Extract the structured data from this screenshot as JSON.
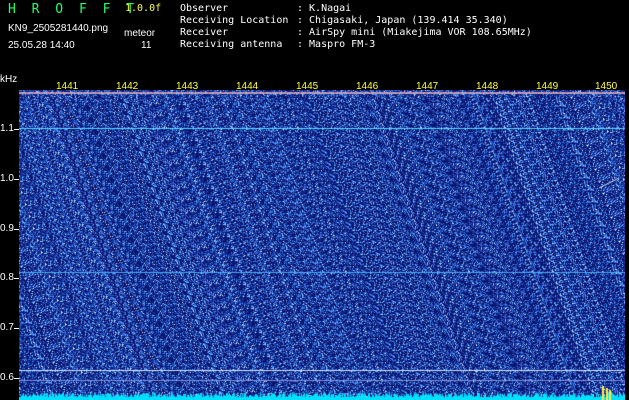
{
  "header": {
    "app_title": "H R O F F T",
    "version": "1.0.0f",
    "file_name": "KN9_2505281440.png",
    "meteor_label": "meteor",
    "datetime": "25.05.28 14:40",
    "meteor_count": "11"
  },
  "info": [
    {
      "key": "Observer",
      "value": ": K.Nagai"
    },
    {
      "key": "Receiving Location",
      "value": ": Chigasaki, Japan (139.414 35.340)"
    },
    {
      "key": "Receiver",
      "value": ": AirSpy mini (Miakejima VOR 108.65MHz)"
    },
    {
      "key": "Receiving antenna",
      "value": ": Maspro FM-3"
    }
  ],
  "spectrogram": {
    "y_unit": "kHz",
    "y_ticks": [
      "1.1",
      "1.0",
      "0.9",
      "0.8",
      "0.7",
      "0.6"
    ],
    "x_ticks": [
      "1441",
      "1442",
      "1443",
      "1444",
      "1445",
      "1446",
      "1447",
      "1448",
      "1449",
      "1450"
    ],
    "colors": {
      "background": "#0a1670",
      "noise": "#3d6cff",
      "line": "#5ad8ff",
      "floor": "#00e0ff"
    }
  }
}
